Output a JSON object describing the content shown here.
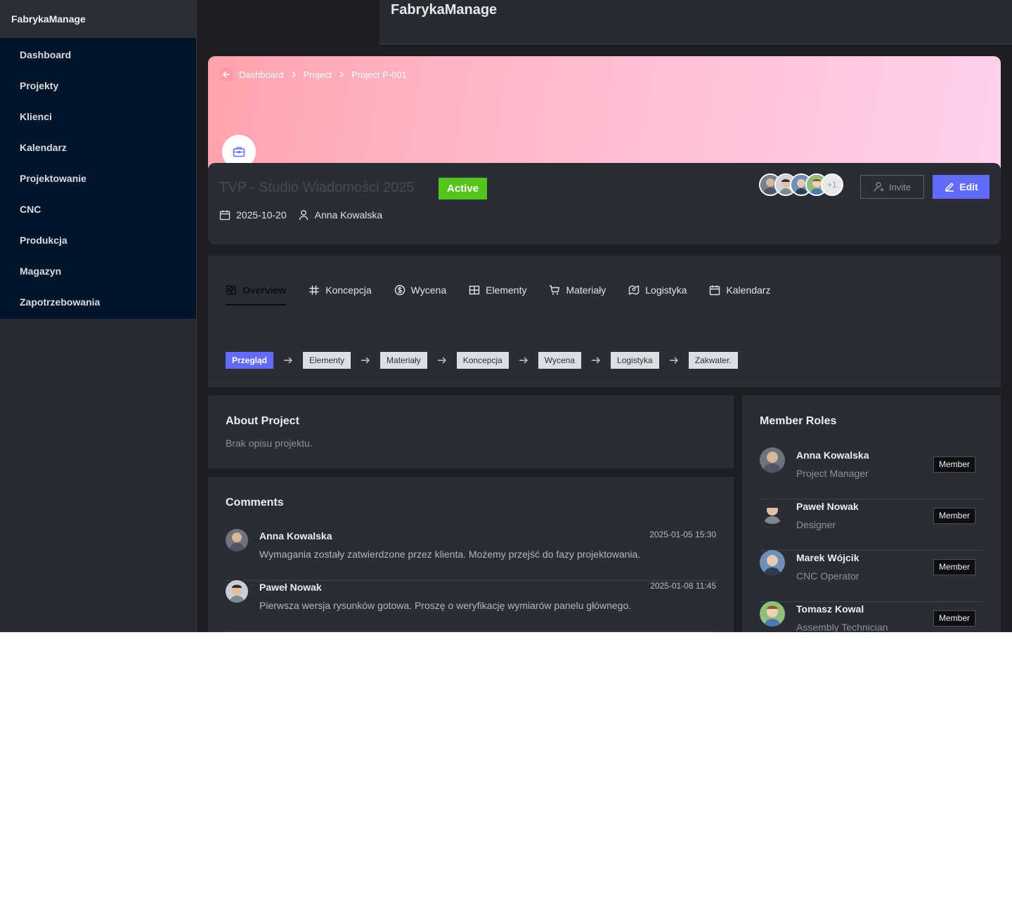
{
  "app": {
    "brand": "FabrykaManage",
    "header_title": "FabrykaManage"
  },
  "sidebar": {
    "items": [
      {
        "label": "Dashboard"
      },
      {
        "label": "Projekty"
      },
      {
        "label": "Klienci"
      },
      {
        "label": "Kalendarz"
      },
      {
        "label": "Projektowanie"
      },
      {
        "label": "CNC"
      },
      {
        "label": "Produkcja"
      },
      {
        "label": "Magazyn"
      },
      {
        "label": "Zapotrzebowania"
      }
    ]
  },
  "breadcrumb": [
    "Dashboard",
    "Project",
    "Project P-001"
  ],
  "project": {
    "title": "TVP - Studio Wiadomości 2025",
    "status": "Active",
    "date": "2025-10-20",
    "owner": "Anna Kowalska",
    "avatars_more": "+1",
    "invite_label": "Invite",
    "edit_label": "Edit"
  },
  "tabs": [
    {
      "label": "Overview",
      "icon": "overview-icon"
    },
    {
      "label": "Koncepcja",
      "icon": "hash-icon"
    },
    {
      "label": "Wycena",
      "icon": "dollar-icon"
    },
    {
      "label": "Elementy",
      "icon": "grid-icon"
    },
    {
      "label": "Materiały",
      "icon": "cart-icon"
    },
    {
      "label": "Logistyka",
      "icon": "map-icon"
    },
    {
      "label": "Kalendarz",
      "icon": "calendar-icon"
    }
  ],
  "steps": [
    "Przegląd",
    "Elementy",
    "Materiały",
    "Koncepcja",
    "Wycena",
    "Logistyka",
    "Zakwater."
  ],
  "about": {
    "title": "About Project",
    "text": "Brak opisu projektu."
  },
  "comments": {
    "title": "Comments",
    "items": [
      {
        "author": "Anna Kowalska",
        "time": "2025-01-05 15:30",
        "text": "Wymagania zostały zatwierdzone przez klienta. Możemy przejść do fazy projektowania."
      },
      {
        "author": "Paweł Nowak",
        "time": "2025-01-08 11:45",
        "text": "Pierwsza wersja rysunków gotowa. Proszę o weryfikację wymiarów panelu głównego."
      }
    ]
  },
  "members": {
    "title": "Member Roles",
    "items": [
      {
        "name": "Anna Kowalska",
        "role": "Project Manager",
        "badge": "Member"
      },
      {
        "name": "Paweł Nowak",
        "role": "Designer",
        "badge": "Member"
      },
      {
        "name": "Marek Wójcik",
        "role": "CNC Operator",
        "badge": "Member"
      },
      {
        "name": "Tomasz Kowal",
        "role": "Assembly Technician",
        "badge": "Member"
      }
    ]
  },
  "colors": {
    "accent": "#636bff",
    "status_active": "#52c41a",
    "sidebar_nav": "#001529"
  }
}
